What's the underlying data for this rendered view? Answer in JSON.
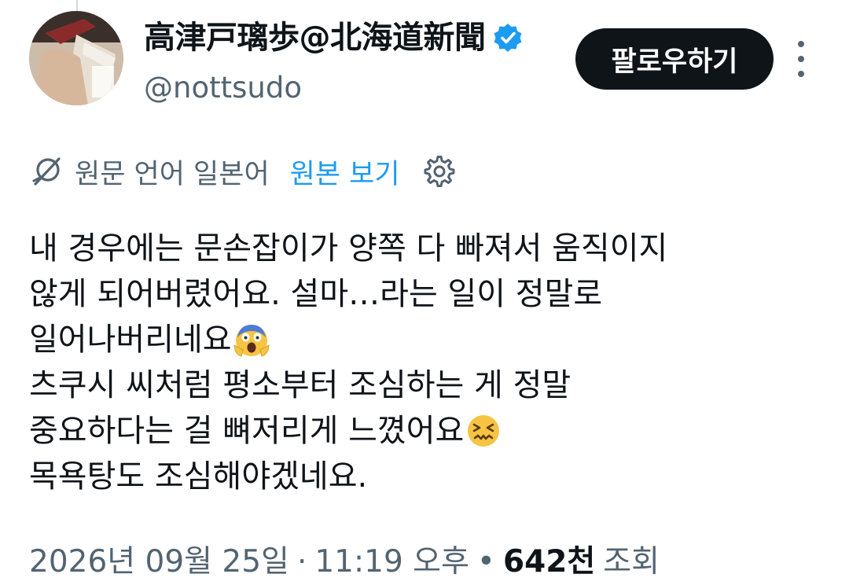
{
  "author": {
    "display_name": "高津戸璃歩@北海道新聞",
    "handle": "@nottsudo",
    "verified": true
  },
  "actions": {
    "follow_label": "팔로우하기",
    "more_icon": "more-vertical-icon"
  },
  "translation": {
    "source_label": "원문 언어 일본어",
    "show_original_label": "원본 보기",
    "icon": "translate-icon",
    "settings_icon": "gear-icon"
  },
  "tweet": {
    "lines": [
      "내 경우에는 문손잡이가 양쪽 다 빠져서 움직이지",
      "않게 되어버렸어요. 설마…라는 일이 정말로",
      "일어나버리네요",
      "츠쿠시 씨처럼 평소부터 조심하는 게 정말",
      "중요하다는 걸 뼈저리게 느꼈어요",
      "목욕탕도 조심해야겠네요."
    ],
    "emojis": {
      "line3": "screaming-face-emoji",
      "line5": "confounded-face-emoji"
    }
  },
  "meta": {
    "date": "2026년 09월 25일",
    "separator": "·",
    "time": "11:19 오후",
    "bullet": "•",
    "views_count": "642천",
    "views_label": "조회"
  },
  "colors": {
    "text_primary": "#0f1419",
    "text_secondary": "#536471",
    "link_blue": "#1d9bf0",
    "verified_blue": "#1d9bf0",
    "button_black": "#0f1419"
  }
}
